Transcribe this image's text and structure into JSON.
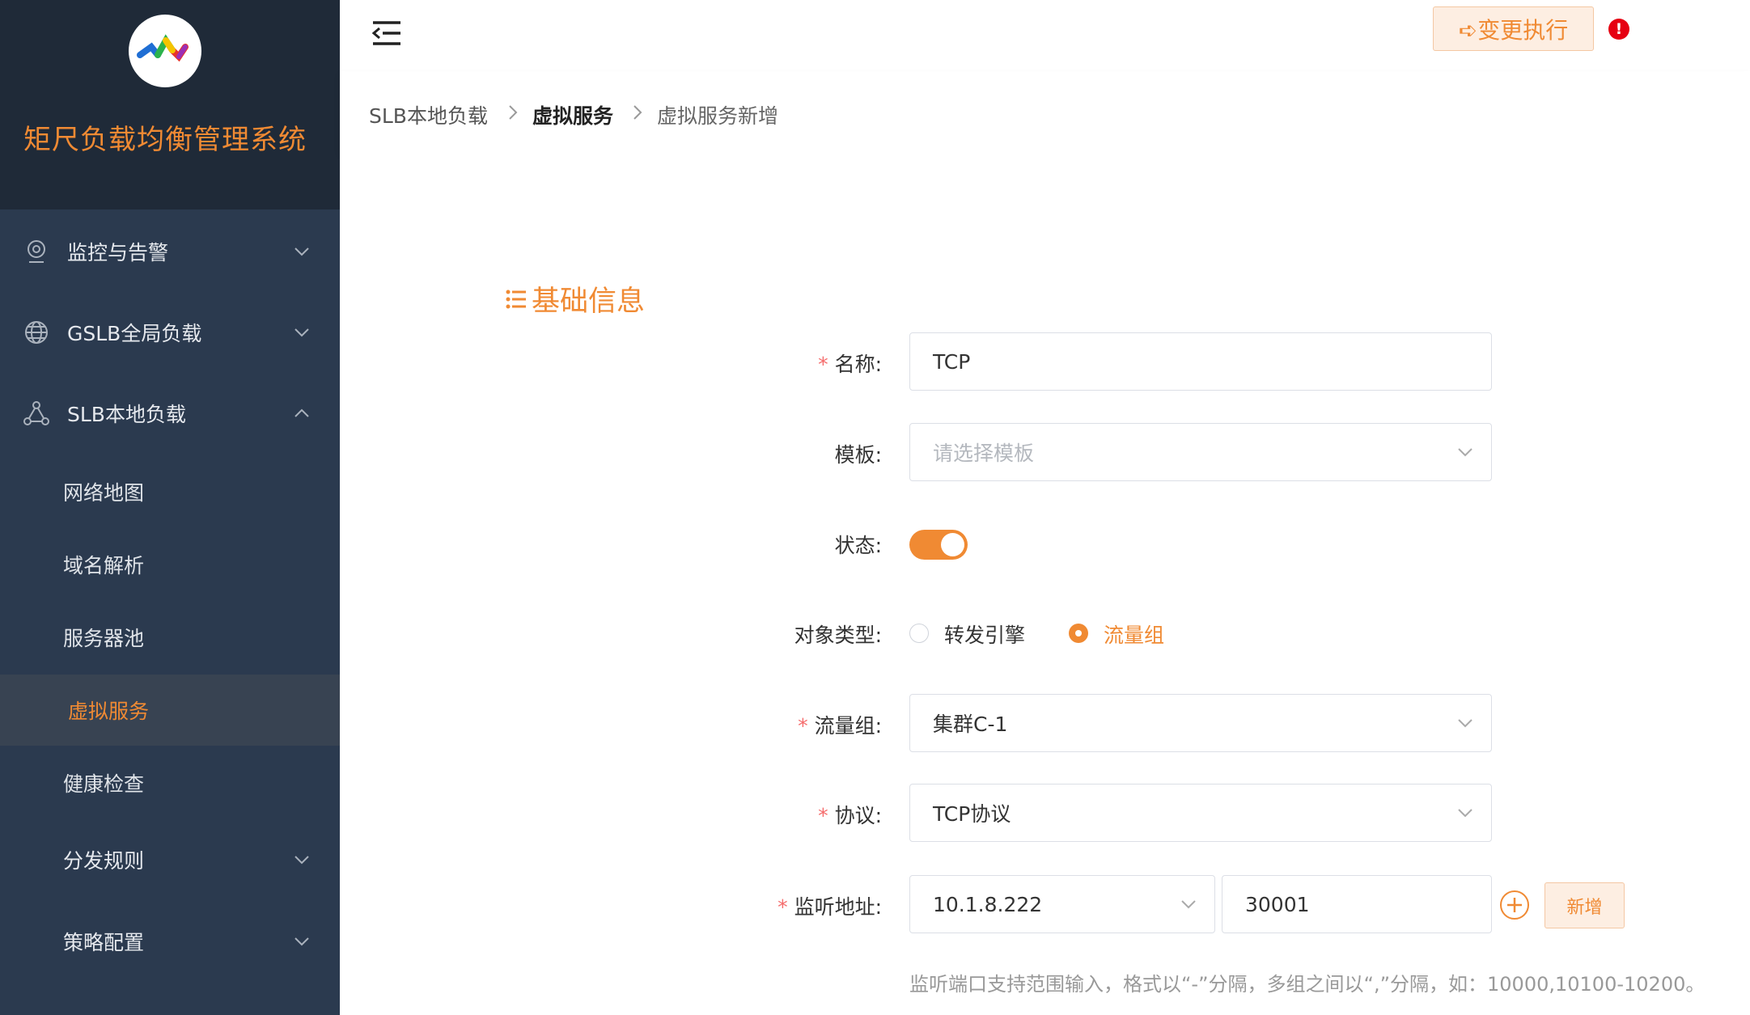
{
  "app": {
    "title": "矩尺负载均衡管理系统"
  },
  "sidebar": {
    "menus": [
      {
        "label": "监控与告警",
        "icon": "location-pin-icon",
        "expanded": false
      },
      {
        "label": "GSLB全局负载",
        "icon": "globe-icon",
        "expanded": false
      },
      {
        "label": "SLB本地负载",
        "icon": "network-nodes-icon",
        "expanded": true
      }
    ],
    "sub_items": [
      {
        "label": "网络地图"
      },
      {
        "label": "域名解析"
      },
      {
        "label": "服务器池"
      },
      {
        "label": "虚拟服务",
        "active": true
      },
      {
        "label": "健康检查"
      }
    ],
    "more_menus": [
      {
        "label": "分发规则",
        "expanded": false
      },
      {
        "label": "策略配置",
        "expanded": false
      }
    ]
  },
  "header": {
    "exec_button": "➪变更执行",
    "alert_badge": "!"
  },
  "breadcrumb": [
    "SLB本地负载",
    "虚拟服务",
    "虚拟服务新增"
  ],
  "section": {
    "title": "基础信息"
  },
  "form": {
    "name": {
      "label": "名称:",
      "value": "TCP",
      "required": true
    },
    "template": {
      "label": "模板:",
      "placeholder": "请选择模板"
    },
    "status": {
      "label": "状态:",
      "on": true
    },
    "object_type": {
      "label": "对象类型:",
      "options": [
        "转发引擎",
        "流量组"
      ],
      "selected": "流量组"
    },
    "traffic_group": {
      "label": "流量组:",
      "value": "集群C-1",
      "required": true
    },
    "protocol": {
      "label": "协议:",
      "value": "TCP协议",
      "required": true
    },
    "listen": {
      "label": "监听地址:",
      "ip": "10.1.8.222",
      "port": "30001",
      "required": true,
      "add_button": "新增"
    },
    "hint": "监听端口支持范围输入，格式以“-”分隔，多组之间以“,”分隔，如：10000,10100-10200。"
  },
  "colors": {
    "accent": "#f08a33",
    "sidebar": "#2b3a4f",
    "sidebar_head": "#1f2a38",
    "required": "#f56c6c",
    "alert": "#e60012"
  }
}
